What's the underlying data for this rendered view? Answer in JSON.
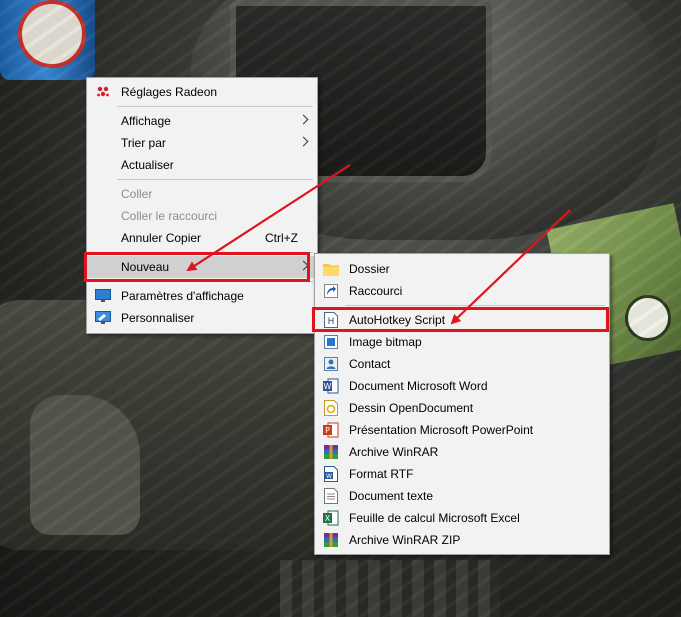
{
  "main_menu": {
    "radeon": "Réglages Radeon",
    "affichage": "Affichage",
    "trier": "Trier par",
    "actualiser": "Actualiser",
    "coller": "Coller",
    "coller_raccourci": "Coller le raccourci",
    "annuler": "Annuler Copier",
    "annuler_shortcut": "Ctrl+Z",
    "nouveau": "Nouveau",
    "parametres": "Paramètres d'affichage",
    "personnaliser": "Personnaliser"
  },
  "sub_menu": {
    "dossier": "Dossier",
    "raccourci": "Raccourci",
    "ahk": "AutoHotkey Script",
    "bitmap": "Image bitmap",
    "contact": "Contact",
    "word": "Document Microsoft Word",
    "odg": "Dessin OpenDocument",
    "ppt": "Présentation Microsoft PowerPoint",
    "winrar": "Archive WinRAR",
    "rtf": "Format RTF",
    "texte": "Document texte",
    "excel": "Feuille de calcul Microsoft Excel",
    "winrar_zip": "Archive WinRAR ZIP"
  },
  "icons": {
    "radeon": "radeon-icon",
    "folder": "folder-icon",
    "shortcut": "shortcut-icon",
    "ahk": "autohotkey-icon",
    "bitmap": "bitmap-icon",
    "contact": "contact-icon",
    "word": "word-icon",
    "odg": "opendocument-drawing-icon",
    "ppt": "powerpoint-icon",
    "winrar": "winrar-icon",
    "rtf": "rtf-icon",
    "text": "text-document-icon",
    "excel": "excel-icon",
    "winrar_zip": "winrar-zip-icon",
    "display": "display-settings-icon",
    "personalize": "personalize-icon"
  },
  "colors": {
    "annotation_red": "#e0141e",
    "menu_bg": "#f2f2f2",
    "highlight": "#d0d0d0"
  }
}
